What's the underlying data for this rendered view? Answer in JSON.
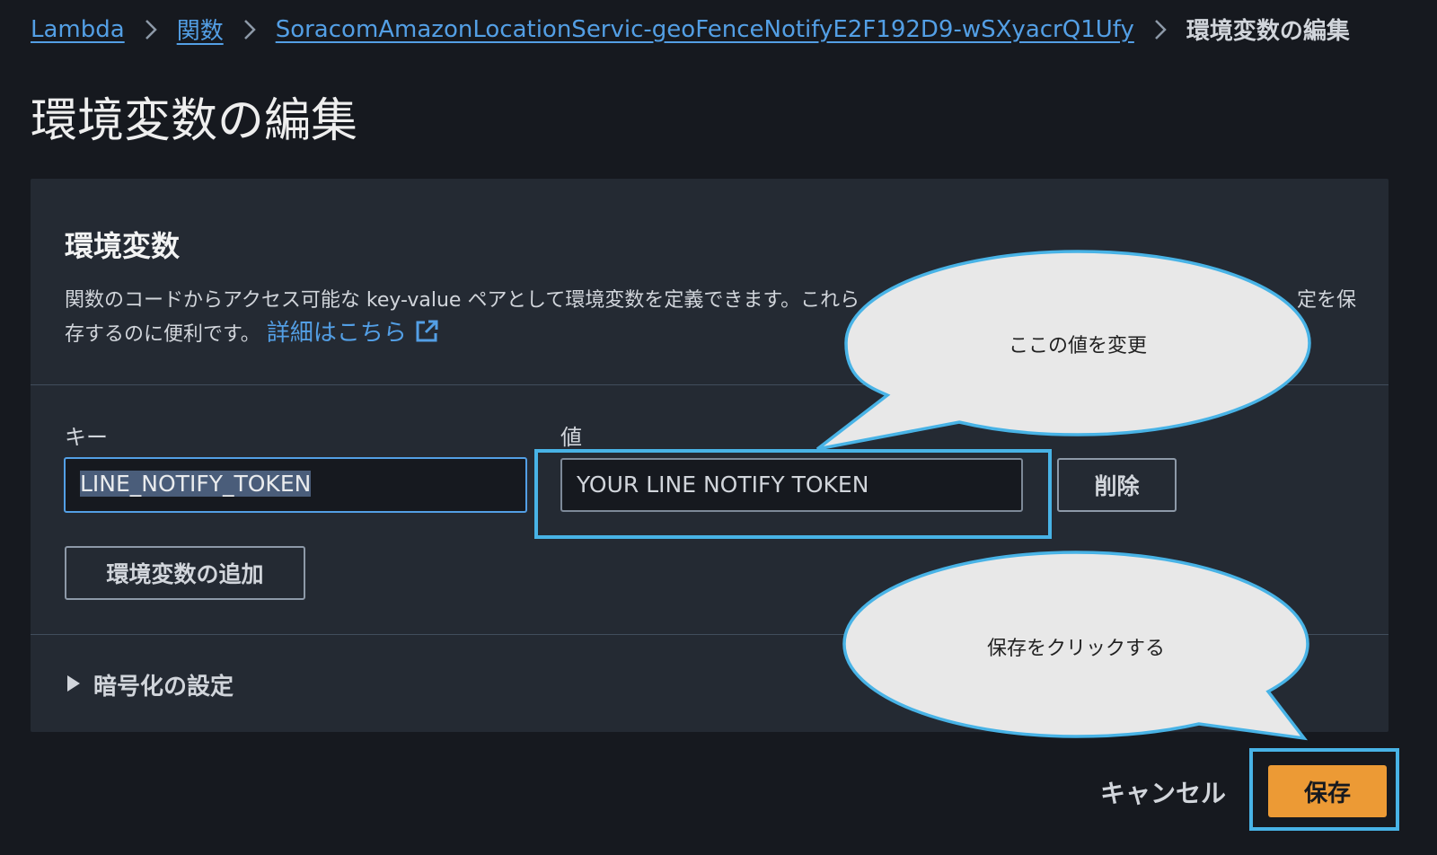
{
  "breadcrumb": {
    "items": [
      "Lambda",
      "関数",
      "SoracomAmazonLocationServic-geoFenceNotifyE2F192D9-wSXyacrQ1Ufy"
    ],
    "current": "環境変数の編集"
  },
  "page": {
    "title": "環境変数の編集"
  },
  "panel": {
    "title": "環境変数",
    "description_line1": "関数のコードからアクセス可能な key-value ペアとして環境変数を定義できます。これら",
    "description_line1_end": "定を保",
    "description_line2": "存するのに便利です。",
    "learn_more": "詳細はこちら"
  },
  "form": {
    "key_label": "キー",
    "value_label": "値",
    "key_value": "LINE_NOTIFY_TOKEN",
    "value_value": "YOUR LINE NOTIFY TOKEN",
    "delete_label": "削除",
    "add_label": "環境変数の追加"
  },
  "encryption": {
    "label": "暗号化の設定"
  },
  "actions": {
    "cancel": "キャンセル",
    "save": "保存"
  },
  "annotations": {
    "callout_value": "ここの値を変更",
    "callout_save": "保存をクリックする"
  },
  "colors": {
    "link": "#539fe5",
    "primary": "#ec9a35",
    "highlight": "#48b3e6"
  }
}
